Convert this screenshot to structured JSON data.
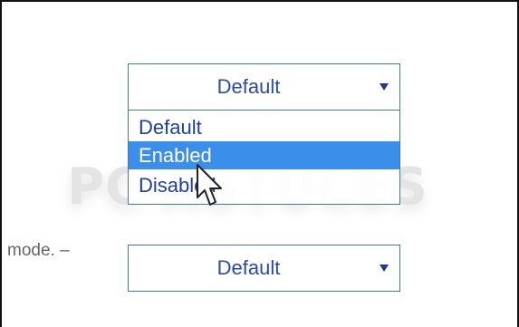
{
  "watermark": {
    "text": "PC ASTUCES"
  },
  "top_select": {
    "value": "Default",
    "icon": "chevron-down-icon",
    "options": [
      "Default",
      "Enabled",
      "Disabled"
    ],
    "highlighted_option": "Enabled"
  },
  "bottom_select": {
    "value": "Default",
    "icon": "chevron-down-icon"
  },
  "side_label": "mode. –",
  "colors": {
    "border": "#4472c4",
    "text": "#1f3f9a",
    "highlight": "#3b8eea"
  },
  "cursor_icon": "mouse-pointer-icon"
}
